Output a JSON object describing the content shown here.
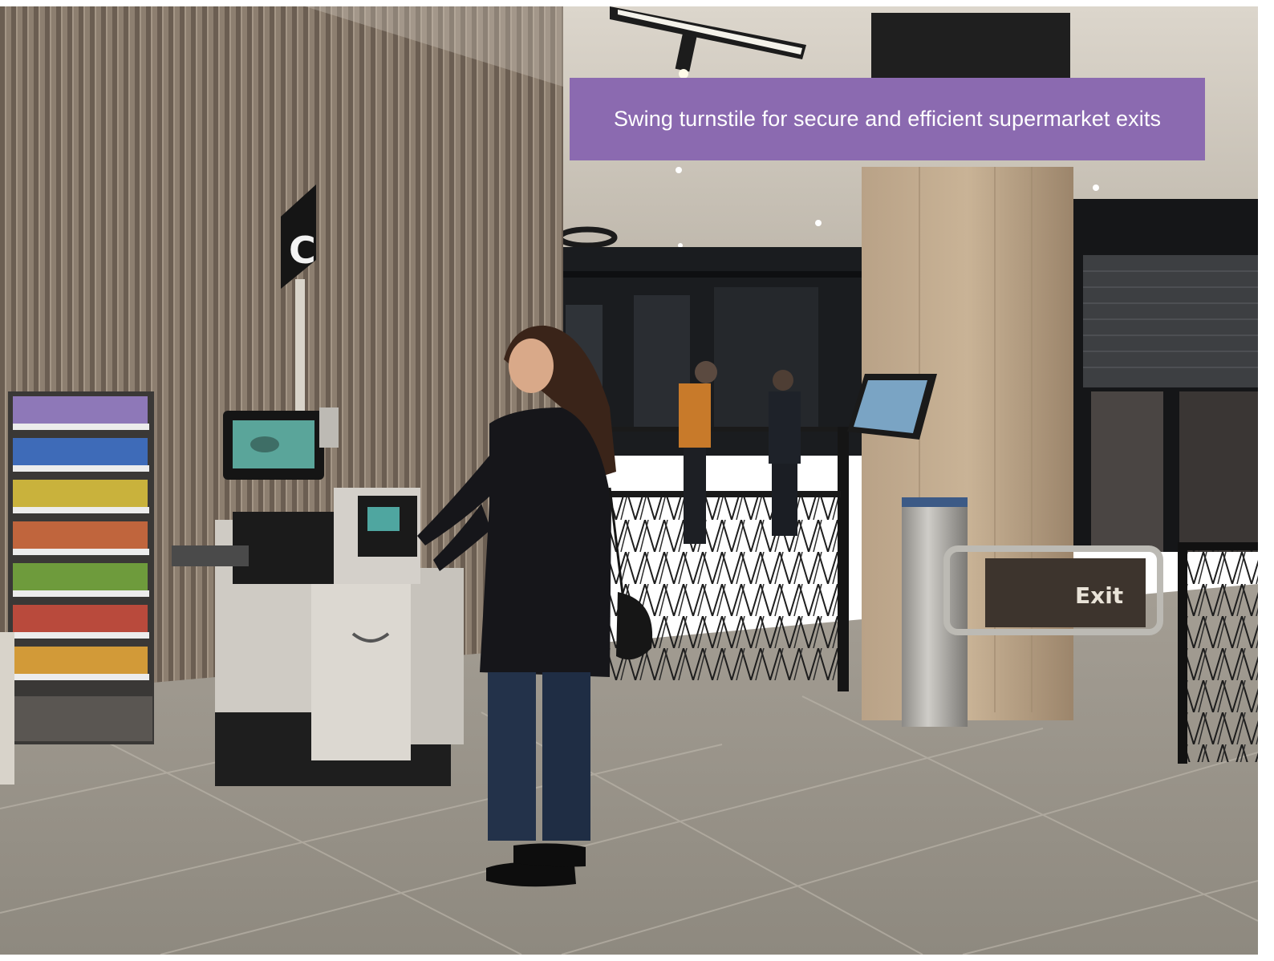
{
  "caption": {
    "text": "Swing turnstile for secure and efficient supermarket exits",
    "background_color": "#8b6ab0",
    "text_color": "#ffffff"
  },
  "scene": {
    "aisle_sign_letter": "C",
    "exit_sign_text": "Exit"
  }
}
